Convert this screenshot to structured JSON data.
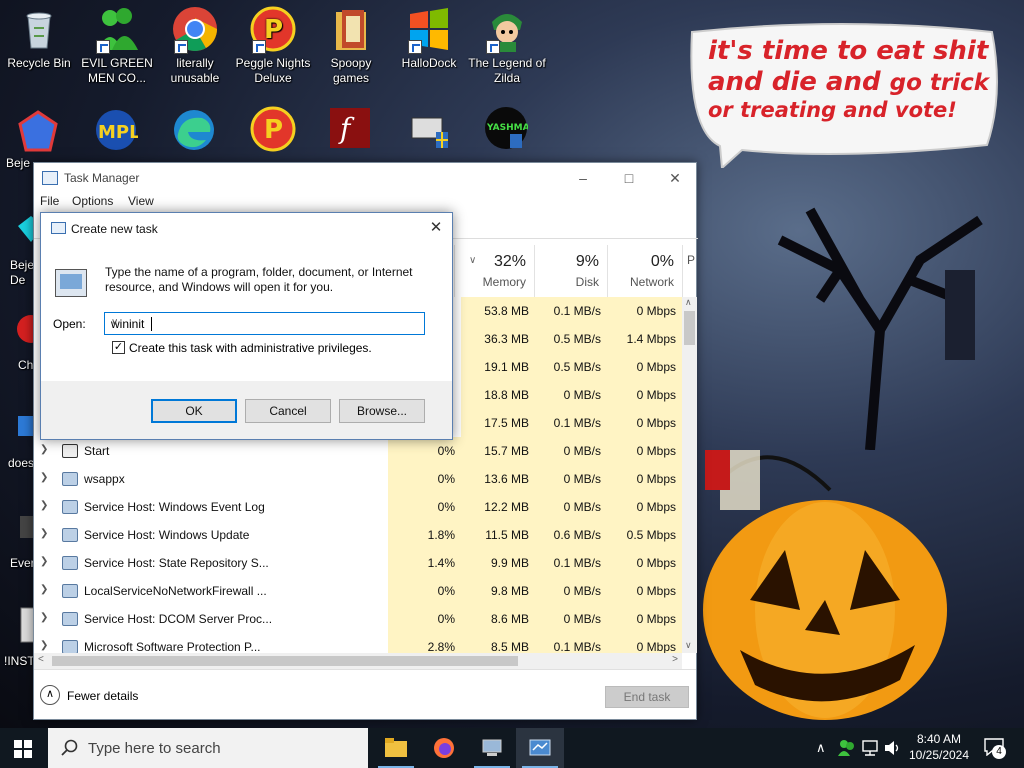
{
  "desktop": {
    "icons": [
      {
        "label": "Recycle Bin",
        "icon": "recycle-bin-icon"
      },
      {
        "label": "EVIL GREEN MEN CO...",
        "icon": "green-men-icon"
      },
      {
        "label": "literally unusable",
        "icon": "chrome-icon"
      },
      {
        "label": "Peggle Nights Deluxe",
        "icon": "peggle-icon"
      },
      {
        "label": "Spoopy games",
        "icon": "folder-icon"
      },
      {
        "label": "HalloDock",
        "icon": "windows-flag-icon"
      },
      {
        "label": "The Legend of Zilda",
        "icon": "zilda-icon"
      }
    ],
    "partial_labels": [
      "Beje",
      "Bejew De",
      "Ch De",
      "does",
      "Ever",
      "!INST"
    ],
    "bubble": {
      "line1": "it's time to eat shit",
      "line2a": "and die and",
      "line2b": "go trick",
      "line3": "or treating and vote!"
    }
  },
  "task_manager": {
    "title": "Task Manager",
    "menu": [
      "File",
      "Options",
      "View"
    ],
    "columns": [
      {
        "pct": "32%",
        "label": "Memory"
      },
      {
        "pct": "9%",
        "label": "Disk"
      },
      {
        "pct": "0%",
        "label": "Network"
      },
      {
        "pct": "",
        "label": "P"
      }
    ],
    "rows_hidden": [
      {
        "mem": "53.8 MB",
        "disk": "0.1 MB/s",
        "net": "0 Mbps"
      },
      {
        "mem": "36.3 MB",
        "disk": "0.5 MB/s",
        "net": "1.4 Mbps"
      },
      {
        "mem": "19.1 MB",
        "disk": "0.5 MB/s",
        "net": "0 Mbps"
      },
      {
        "mem": "18.8 MB",
        "disk": "0 MB/s",
        "net": "0 Mbps"
      },
      {
        "mem": "17.5 MB",
        "disk": "0.1 MB/s",
        "net": "0 Mbps"
      }
    ],
    "rows": [
      {
        "name": "Start",
        "cpu": "0%",
        "mem": "15.7 MB",
        "disk": "0 MB/s",
        "net": "0 Mbps"
      },
      {
        "name": "wsappx",
        "cpu": "0%",
        "mem": "13.6 MB",
        "disk": "0 MB/s",
        "net": "0 Mbps"
      },
      {
        "name": "Service Host: Windows Event Log",
        "cpu": "0%",
        "mem": "12.2 MB",
        "disk": "0 MB/s",
        "net": "0 Mbps"
      },
      {
        "name": "Service Host: Windows Update",
        "cpu": "1.8%",
        "mem": "11.5 MB",
        "disk": "0.6 MB/s",
        "net": "0.5 Mbps"
      },
      {
        "name": "Service Host: State Repository S...",
        "cpu": "1.4%",
        "mem": "9.9 MB",
        "disk": "0.1 MB/s",
        "net": "0 Mbps"
      },
      {
        "name": "LocalServiceNoNetworkFirewall ...",
        "cpu": "0%",
        "mem": "9.8 MB",
        "disk": "0 MB/s",
        "net": "0 Mbps"
      },
      {
        "name": "Service Host: DCOM Server Proc...",
        "cpu": "0%",
        "mem": "8.6 MB",
        "disk": "0 MB/s",
        "net": "0 Mbps"
      },
      {
        "name": "Microsoft Software Protection P...",
        "cpu": "2.8%",
        "mem": "8.5 MB",
        "disk": "0.1 MB/s",
        "net": "0 Mbps"
      }
    ],
    "fewer_details": "Fewer details",
    "end_task": "End task"
  },
  "dialog": {
    "title": "Create new task",
    "description": "Type the name of a program, folder, document, or Internet resource, and Windows will open it for you.",
    "open_label": "Open:",
    "open_value": "wininit",
    "admin_label": "Create this task with administrative privileges.",
    "admin_checked": "✓",
    "ok": "OK",
    "cancel": "Cancel",
    "browse": "Browse..."
  },
  "taskbar": {
    "search_placeholder": "Type here to search",
    "time": "8:40 AM",
    "date": "10/25/2024",
    "notifications": "4"
  },
  "colors": {
    "accent": "#0078d7",
    "heat": "#fff4c4",
    "bubble_text": "#d8232a"
  }
}
